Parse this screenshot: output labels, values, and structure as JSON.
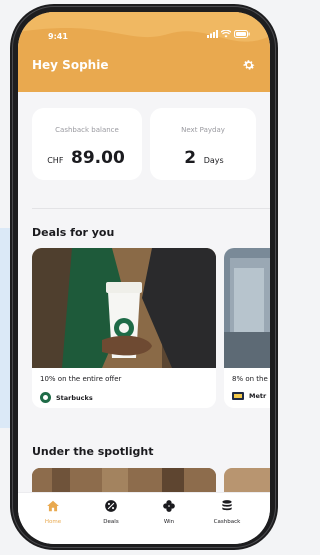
{
  "status": {
    "time": "9:41"
  },
  "header": {
    "greeting": "Hey Sophie"
  },
  "stats": {
    "cashback_label": "Cashback balance",
    "cashback_currency": "CHF",
    "cashback_value": "89.00",
    "payday_label": "Next Payday",
    "payday_value": "2",
    "payday_unit": "Days"
  },
  "deals": {
    "title": "Deals for you",
    "items": [
      {
        "title": "10% on the entire offer",
        "brand": "Starbucks"
      },
      {
        "title": "8% on the",
        "brand": "Metr"
      }
    ]
  },
  "spotlight": {
    "title": "Under the spotlight"
  },
  "tabs": [
    {
      "label": "Home",
      "icon": "home-icon",
      "active": true
    },
    {
      "label": "Deals",
      "icon": "deals-icon",
      "active": false
    },
    {
      "label": "Win",
      "icon": "clover-icon",
      "active": false
    },
    {
      "label": "Cashback",
      "icon": "coins-icon",
      "active": false
    }
  ],
  "colors": {
    "accent": "#e9a94f",
    "background": "#f5f5f7",
    "text": "#1b1b1f",
    "starbucks_green": "#1e6b47"
  }
}
